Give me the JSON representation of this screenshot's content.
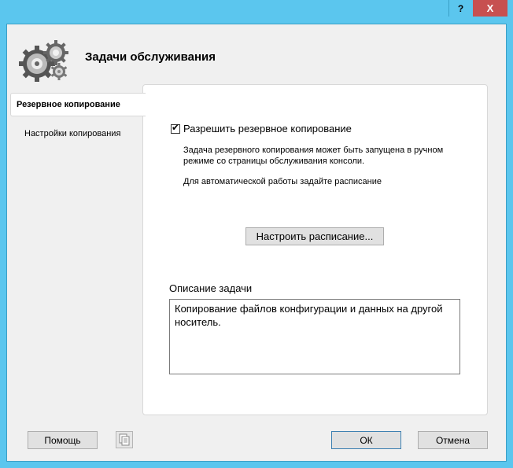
{
  "window": {
    "help_glyph": "?",
    "close_glyph": "X"
  },
  "header": {
    "title": "Задачи обслуживания",
    "icon": "gears-icon"
  },
  "sidebar": {
    "items": [
      {
        "label": "Резервное копирование",
        "active": true
      },
      {
        "label": "Настройки копирования",
        "active": false
      }
    ]
  },
  "panel": {
    "enable_checkbox": {
      "label": "Разрешить резервное копирование",
      "checked": true
    },
    "info_line1": "Задача резервного копирования может быть запущена в ручном",
    "info_line2": "режиме со страницы обслуживания консоли.",
    "info_line3": "Для автоматической работы задайте расписание",
    "schedule_button": "Настроить расписание...",
    "description_label": "Описание задачи",
    "description_text": "Копирование файлов конфигурации и данных на другой носитель."
  },
  "footer": {
    "help_button": "Помощь",
    "ok_button": "ОК",
    "cancel_button": "Отмена"
  },
  "colors": {
    "frame": "#5bc6ee",
    "close": "#c75050",
    "dialog_bg": "#f0f0f0"
  }
}
